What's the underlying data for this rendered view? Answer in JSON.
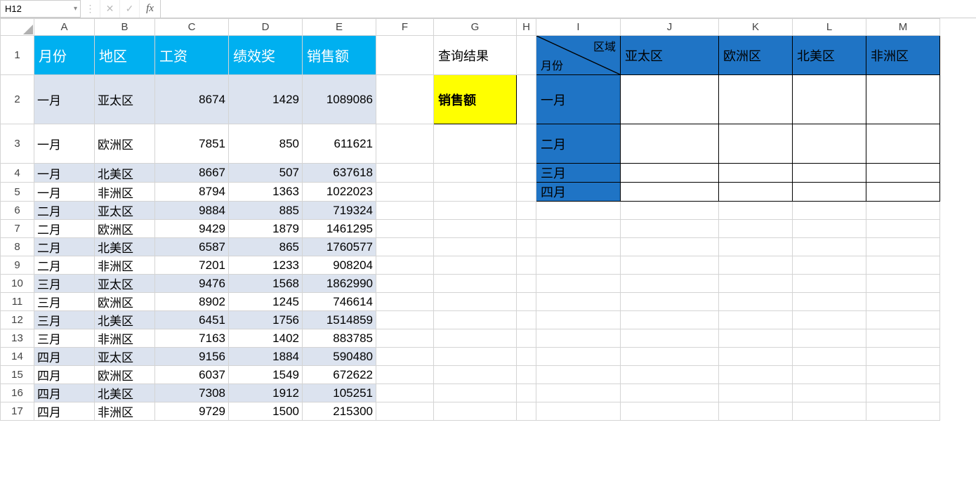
{
  "formula_bar": {
    "cell_ref": "H12",
    "fx_label": "fx",
    "formula": ""
  },
  "columns": [
    "A",
    "B",
    "C",
    "D",
    "E",
    "F",
    "G",
    "H",
    "I",
    "J",
    "K",
    "L",
    "M"
  ],
  "rows": [
    1,
    2,
    3,
    4,
    5,
    6,
    7,
    8,
    9,
    10,
    11,
    12,
    13,
    14,
    15,
    16,
    17
  ],
  "data_headers": {
    "A": "月份",
    "B": "地区",
    "C": "工资",
    "D": "绩效奖",
    "E": "销售额"
  },
  "data_rows": [
    {
      "month": "一月",
      "region": "亚太区",
      "salary": 8674,
      "bonus": 1429,
      "sales": 1089086
    },
    {
      "month": "一月",
      "region": "欧洲区",
      "salary": 7851,
      "bonus": 850,
      "sales": 611621
    },
    {
      "month": "一月",
      "region": "北美区",
      "salary": 8667,
      "bonus": 507,
      "sales": 637618
    },
    {
      "month": "一月",
      "region": "非洲区",
      "salary": 8794,
      "bonus": 1363,
      "sales": 1022023
    },
    {
      "month": "二月",
      "region": "亚太区",
      "salary": 9884,
      "bonus": 885,
      "sales": 719324
    },
    {
      "month": "二月",
      "region": "欧洲区",
      "salary": 9429,
      "bonus": 1879,
      "sales": 1461295
    },
    {
      "month": "二月",
      "region": "北美区",
      "salary": 6587,
      "bonus": 865,
      "sales": 1760577
    },
    {
      "month": "二月",
      "region": "非洲区",
      "salary": 7201,
      "bonus": 1233,
      "sales": 908204
    },
    {
      "month": "三月",
      "region": "亚太区",
      "salary": 9476,
      "bonus": 1568,
      "sales": 1862990
    },
    {
      "month": "三月",
      "region": "欧洲区",
      "salary": 8902,
      "bonus": 1245,
      "sales": 746614
    },
    {
      "month": "三月",
      "region": "北美区",
      "salary": 6451,
      "bonus": 1756,
      "sales": 1514859
    },
    {
      "month": "三月",
      "region": "非洲区",
      "salary": 7163,
      "bonus": 1402,
      "sales": 883785
    },
    {
      "month": "四月",
      "region": "亚太区",
      "salary": 9156,
      "bonus": 1884,
      "sales": 590480
    },
    {
      "month": "四月",
      "region": "欧洲区",
      "salary": 6037,
      "bonus": 1549,
      "sales": 672622
    },
    {
      "month": "四月",
      "region": "北美区",
      "salary": 7308,
      "bonus": 1912,
      "sales": 105251
    },
    {
      "month": "四月",
      "region": "非洲区",
      "salary": 9729,
      "bonus": 1500,
      "sales": 215300
    }
  ],
  "lookup": {
    "label": "查询结果",
    "value": "销售额"
  },
  "pivot": {
    "corner_top": "区域",
    "corner_bottom": "月份",
    "col_headers": [
      "亚太区",
      "欧洲区",
      "北美区",
      "非洲区"
    ],
    "row_headers": [
      "一月",
      "二月",
      "三月",
      "四月"
    ]
  },
  "col_widths": {
    "A": 86,
    "B": 86,
    "C": 105,
    "D": 105,
    "E": 105,
    "F": 82,
    "G": 118,
    "H": 28,
    "I": 120,
    "J": 140,
    "K": 105,
    "L": 105,
    "M": 105
  }
}
